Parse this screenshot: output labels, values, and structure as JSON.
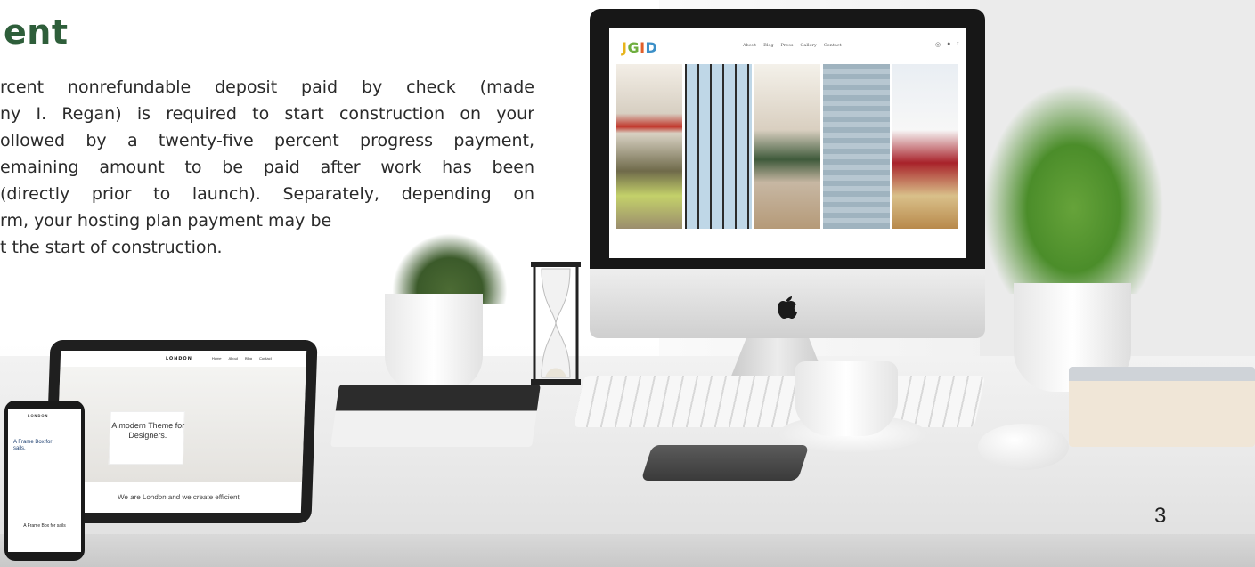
{
  "document": {
    "heading": "ent",
    "paragraph_lines": [
      "rcent nonrefundable deposit paid by check (made",
      "ny I. Regan) is required to start construction on your",
      "ollowed by a twenty-five percent progress payment,",
      "emaining amount to be paid after work has been",
      "(directly prior to launch). Separately, depending on",
      "rm, your hosting plan payment may be",
      "t the start of construction."
    ],
    "page_number": "3"
  },
  "imac_site": {
    "logo_letters": [
      "J",
      "G",
      "I",
      "D"
    ],
    "nav": [
      "About",
      "Blog",
      "Press",
      "Gallery",
      "Contact"
    ]
  },
  "tablet_site": {
    "logo": "LONDON",
    "nav": [
      "Home",
      "About",
      "Blog",
      "Contact"
    ],
    "hero_title": "A modern Theme for Designers.",
    "footer_text": "We are London and we create efficient"
  },
  "phone_site": {
    "logo": "LONDON",
    "headline": "A Frame Box for sails.",
    "subheadline": "A Frame Box for sails"
  },
  "colors": {
    "heading": "#2e5e3a",
    "body_text": "#2a2a2a"
  }
}
